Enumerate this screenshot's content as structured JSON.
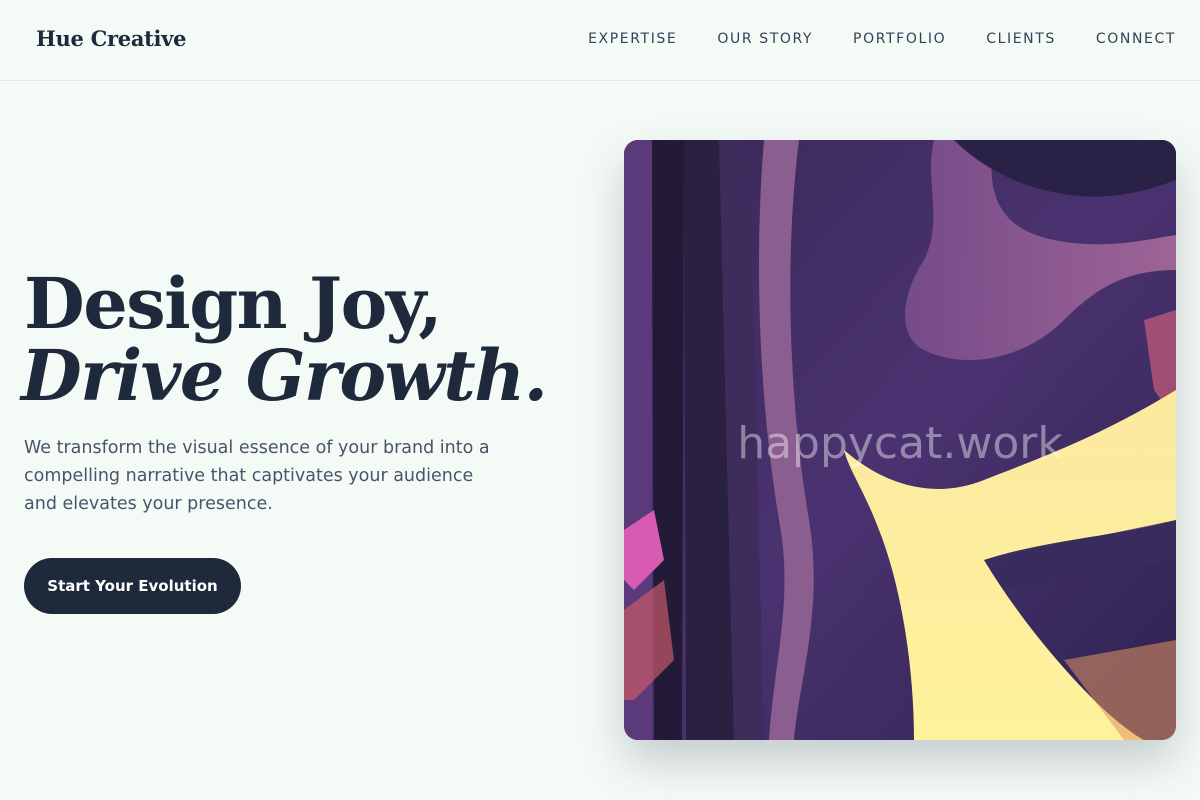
{
  "header": {
    "brand": "Hue Creative",
    "nav": [
      "EXPERTISE",
      "OUR STORY",
      "PORTFOLIO",
      "CLIENTS",
      "CONNECT"
    ]
  },
  "hero": {
    "headline_line1": "Design Joy,",
    "headline_line2": "Drive Growth.",
    "subtitle": "We transform the visual essence of your brand into a compelling narrative that captivates your audience and elevates your presence.",
    "cta_label": "Start Your Evolution",
    "image_watermark": "happycat.work"
  },
  "colors": {
    "background": "#f4fbf7",
    "text_dark": "#1e293b",
    "cta_bg": "#1e293b",
    "art_purple": "#3e2c5e",
    "art_yellow": "#fdf0a0",
    "art_pink": "#d75bb0"
  }
}
